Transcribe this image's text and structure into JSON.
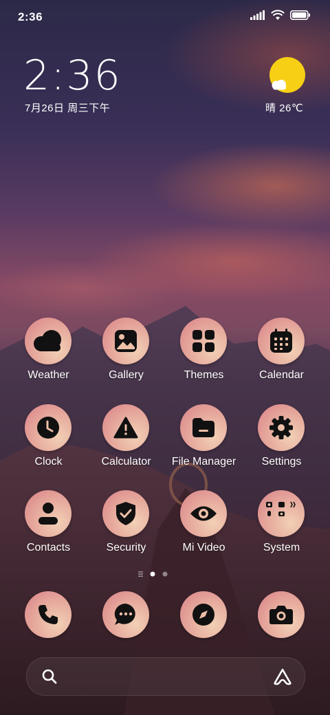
{
  "status_bar": {
    "time": "2:36",
    "icons": [
      "signal-icon",
      "wifi-icon",
      "battery-icon"
    ]
  },
  "clock_widget": {
    "time": "2:36",
    "date": "7月26日 周三下午"
  },
  "weather_widget": {
    "text": "晴 26℃",
    "icon": "sunny-icon"
  },
  "apps": [
    {
      "label": "Weather",
      "icon": "weather-icon"
    },
    {
      "label": "Gallery",
      "icon": "gallery-icon"
    },
    {
      "label": "Themes",
      "icon": "themes-icon"
    },
    {
      "label": "Calendar",
      "icon": "calendar-icon"
    },
    {
      "label": "Clock",
      "icon": "clock-icon"
    },
    {
      "label": "Calculator",
      "icon": "calculator-icon"
    },
    {
      "label": "File Manager",
      "icon": "folder-icon"
    },
    {
      "label": "Settings",
      "icon": "gear-icon"
    },
    {
      "label": "Contacts",
      "icon": "contacts-icon"
    },
    {
      "label": "Security",
      "icon": "shield-icon"
    },
    {
      "label": "Mi Video",
      "icon": "eye-icon"
    },
    {
      "label": "System",
      "icon": "folder-grid-icon"
    }
  ],
  "page_indicator": {
    "pages": 2,
    "current": 1
  },
  "dock": [
    {
      "icon": "phone-icon"
    },
    {
      "icon": "message-icon"
    },
    {
      "icon": "compass-icon"
    },
    {
      "icon": "camera-icon"
    }
  ],
  "search_bar": {
    "icons": [
      "search-icon",
      "assistant-icon"
    ]
  },
  "colors": {
    "icon_gradient_light": "#f2d0b5",
    "icon_gradient_dark": "#d97f86",
    "sun": "#f7cf14"
  }
}
